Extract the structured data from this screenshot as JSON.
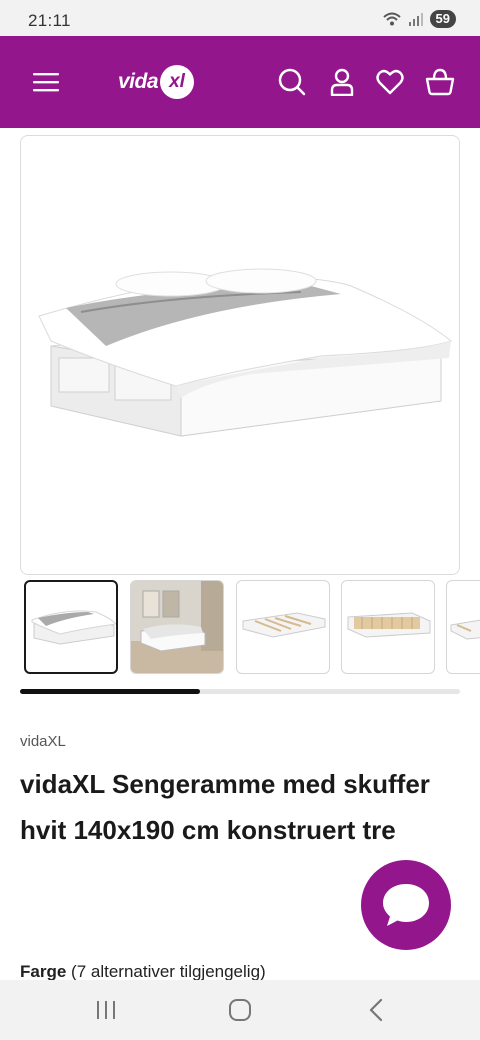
{
  "status_bar": {
    "time": "21:11",
    "battery": "59"
  },
  "header": {
    "logo_text": "vida",
    "logo_badge": "xl",
    "icons": [
      "menu-icon",
      "search-icon",
      "account-icon",
      "heart-icon",
      "basket-icon"
    ],
    "background": "#93168c"
  },
  "gallery": {
    "thumbnail_count": 5,
    "active_index": 0,
    "scroll_progress_percent": 41
  },
  "product": {
    "brand": "vidaXL",
    "title": "vidaXL Sengeramme med skuffer hvit 140x190 cm konstruert tre"
  },
  "color": {
    "label": "Farge",
    "alternatives": "(7 alternativer tilgjengelig)"
  },
  "chat": {
    "icon": "chat-bubble-icon"
  },
  "nav": {
    "icons": [
      "recent-apps-icon",
      "home-icon",
      "back-icon"
    ]
  }
}
